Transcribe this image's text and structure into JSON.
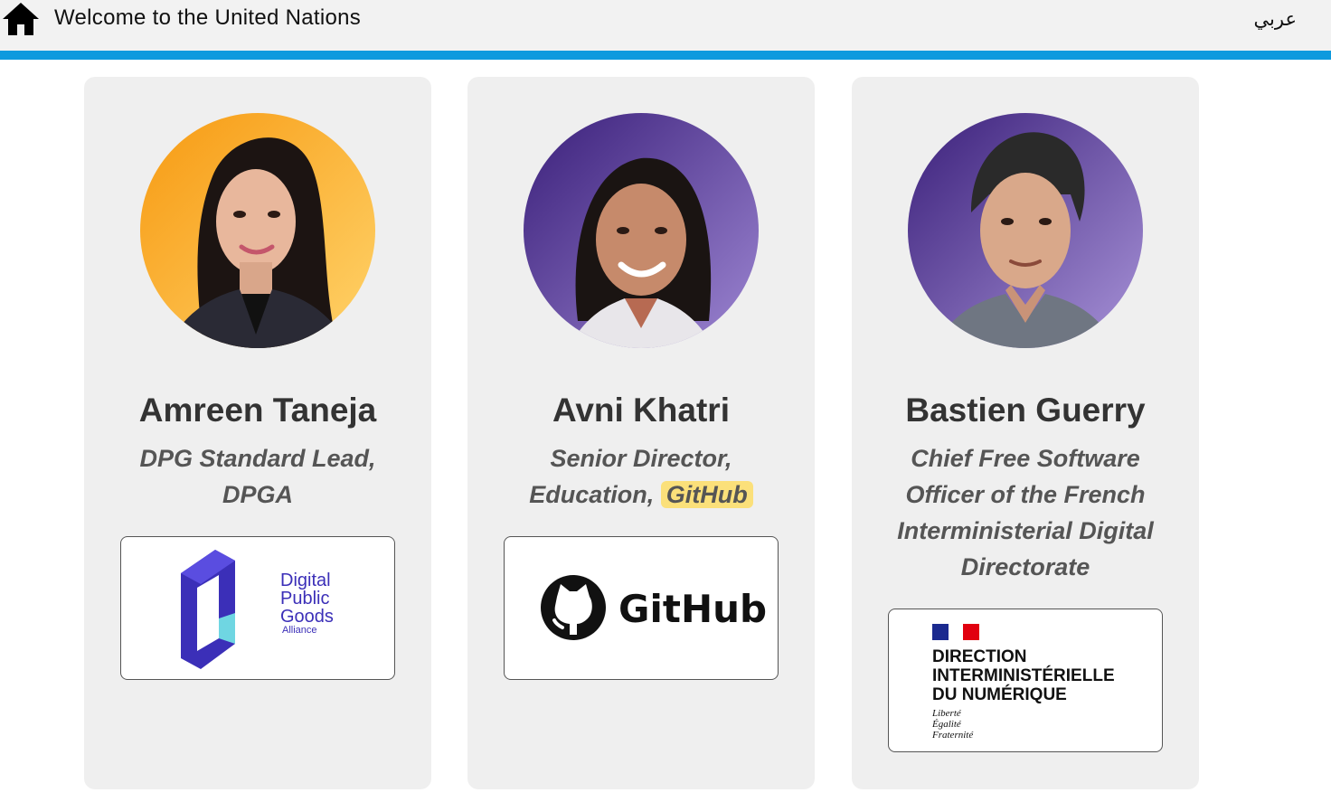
{
  "header": {
    "title": "Welcome to the United Nations",
    "language_link": "عربي",
    "home_icon": "home-icon",
    "accent_color": "#0e9ade"
  },
  "speakers": [
    {
      "name": "Amreen Taneja",
      "role_lines": [
        "DPG Standard Lead,",
        "DPGA"
      ],
      "portrait_background": "#f7a21b",
      "logo": {
        "icon": "digital-public-goods-alliance-logo",
        "lines": [
          "Digital",
          "Public",
          "Goods",
          "Alliance"
        ]
      }
    },
    {
      "name": "Avni Khatri",
      "role_line_1": "Senior Director,",
      "role_line_2_prefix": "Education,",
      "role_highlight": "GitHub",
      "portrait_background": "#4b2a8a",
      "logo": {
        "icon": "github-logo",
        "text": "GitHub"
      }
    },
    {
      "name": "Bastien Guerry",
      "role_lines": [
        "Chief Free Software",
        "Officer of the French",
        "Interministerial Digital",
        "Directorate"
      ],
      "portrait_background": "#4b2a8a",
      "logo": {
        "icon": "marianne-flag-logo",
        "lines": [
          "DIRECTION",
          "INTERMINISTÉRIELLE",
          "DU NUMÉRIQUE"
        ],
        "motto": [
          "Liberté",
          "Égalité",
          "Fraternité"
        ]
      }
    }
  ]
}
